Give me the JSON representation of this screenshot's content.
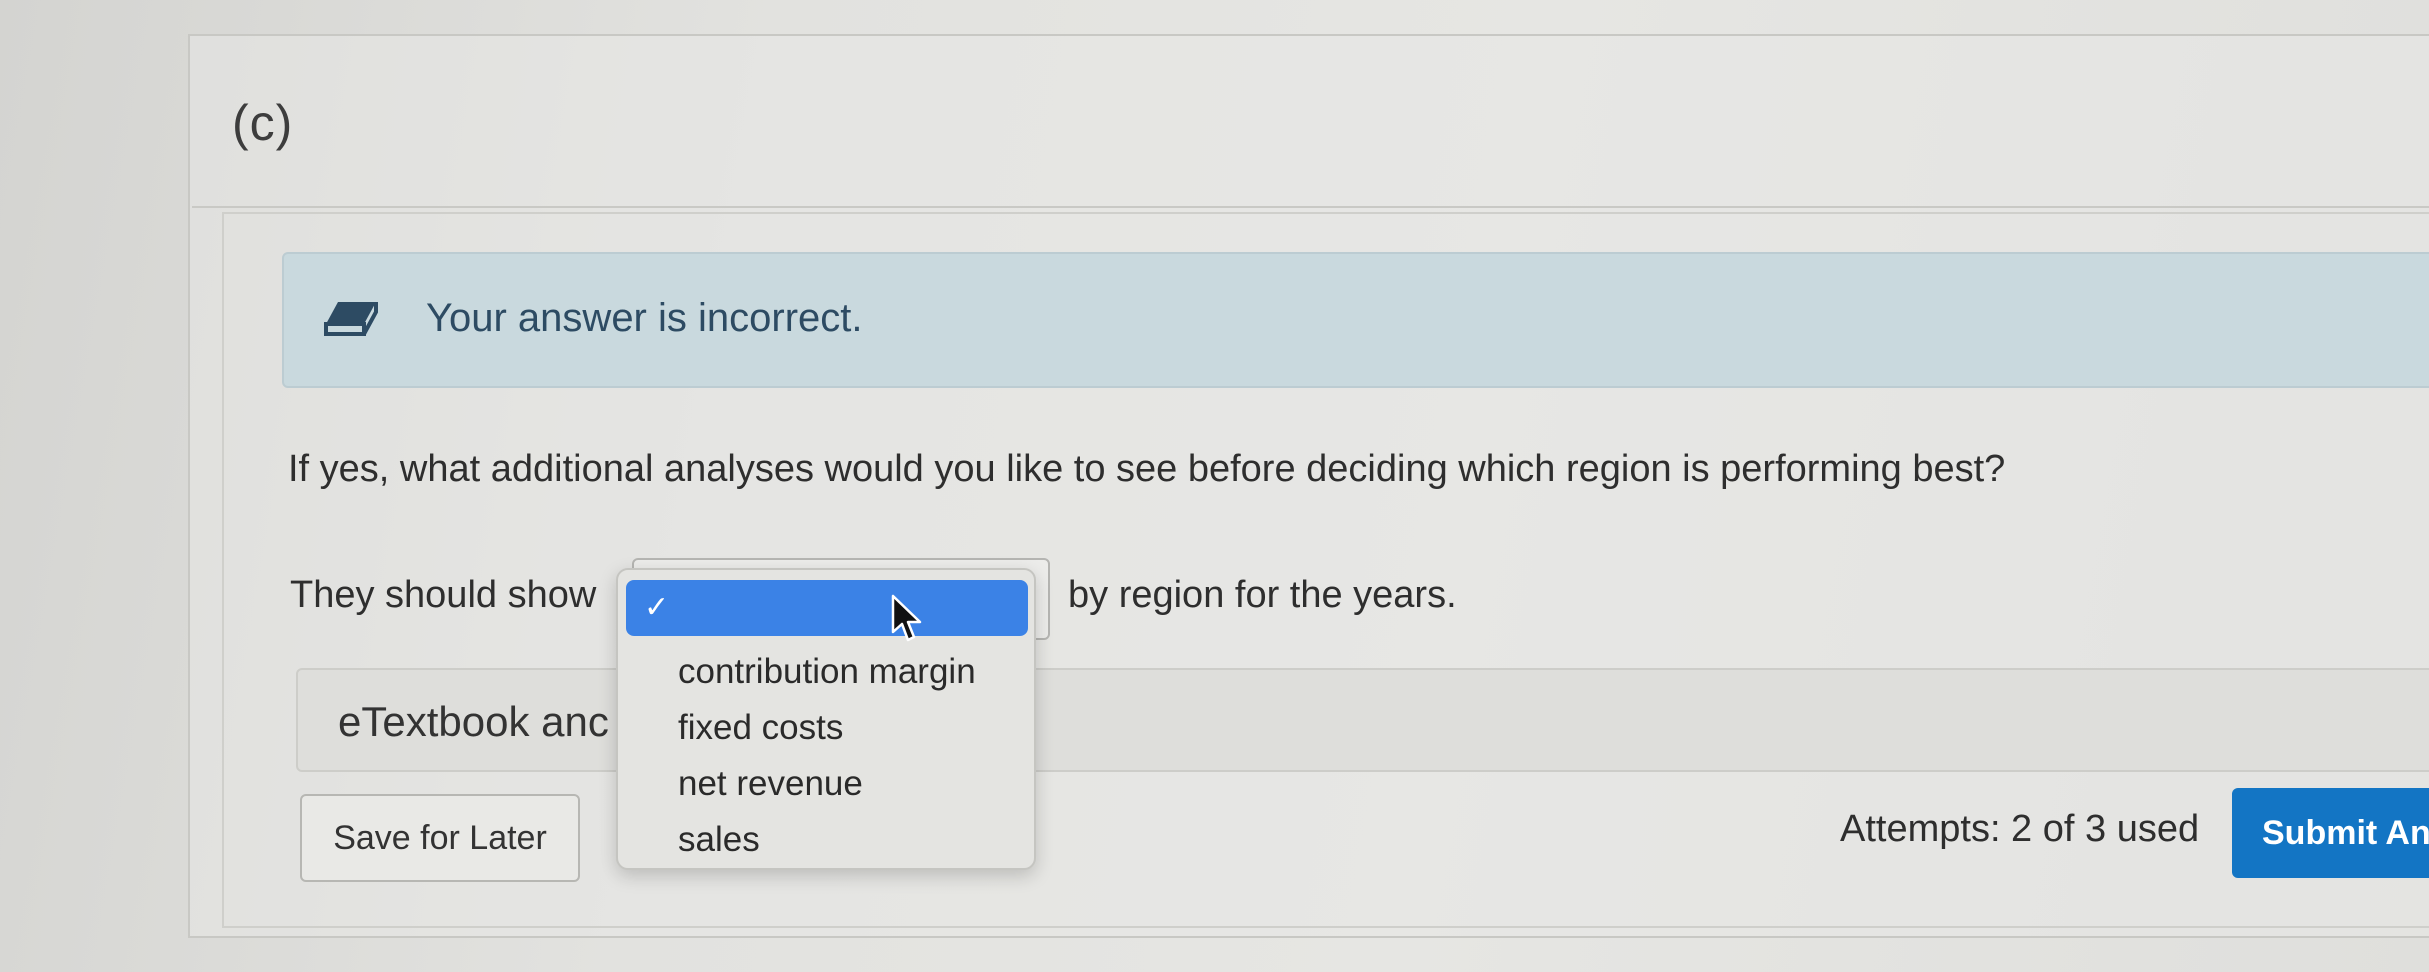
{
  "part": {
    "label": "(c)"
  },
  "alert": {
    "icon": "eraser-icon",
    "message": "Your answer is incorrect.",
    "colors": {
      "background": "#c9d9de",
      "text": "#2d4b63"
    }
  },
  "question": {
    "text": "If yes, what additional analyses would you like to see before deciding which region is performing best?",
    "sentence_prefix": "They should show",
    "sentence_suffix": "by region for the years."
  },
  "dropdown": {
    "selected_icon": "check-icon",
    "selected_mark": "✓",
    "selected_value": "",
    "options": [
      "contribution margin",
      "fixed costs",
      "net revenue",
      "sales"
    ],
    "highlight_color": "#3b82e6"
  },
  "etextbook": {
    "label": "eTextbook anc"
  },
  "actions": {
    "save_label": "Save for Later",
    "attempts_text": "Attempts: 2 of 3 used",
    "submit_label": "Submit Ans",
    "submit_color": "#1375c4"
  }
}
